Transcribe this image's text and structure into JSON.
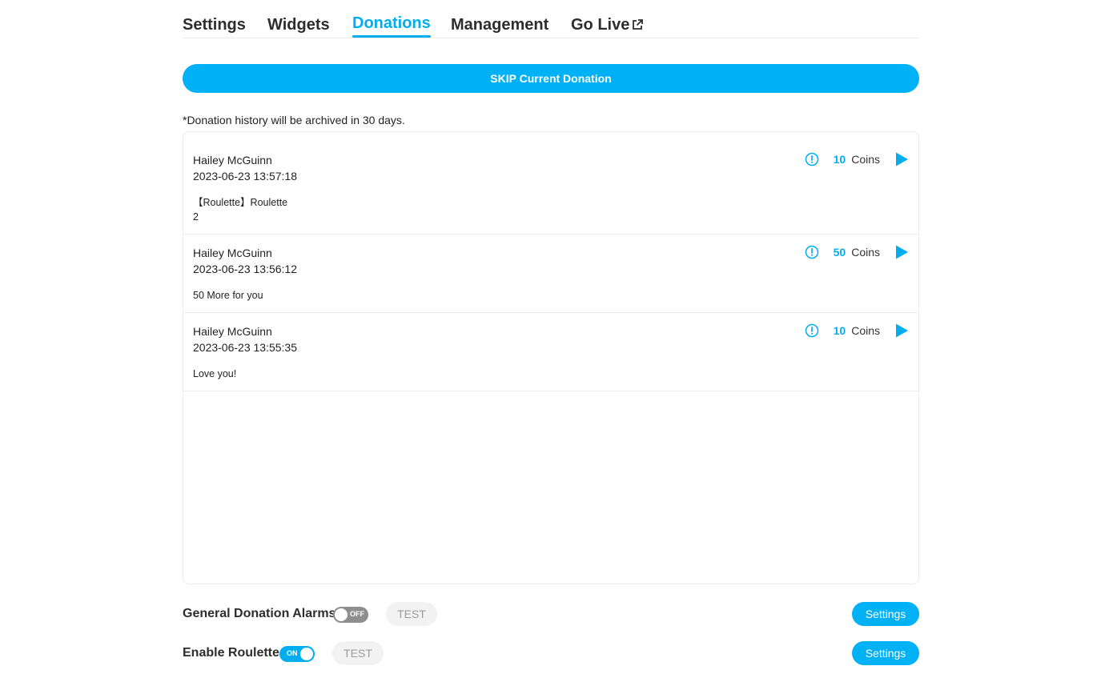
{
  "tabs": [
    {
      "label": "Settings"
    },
    {
      "label": "Widgets"
    },
    {
      "label": "Donations",
      "active": true
    },
    {
      "label": "Management"
    },
    {
      "label": "Go Live",
      "icon": "external-link-icon"
    }
  ],
  "skip_label": "SKIP Current Donation",
  "notice": "*Donation history will be archived in 30 days.",
  "donations": [
    {
      "name": "Hailey McGuinn",
      "time": "2023-06-23 13:57:18",
      "message_line1": "【Roulette】Roulette",
      "message_line2": "2",
      "amount": "10",
      "unit": "Coins"
    },
    {
      "name": "Hailey McGuinn",
      "time": "2023-06-23 13:56:12",
      "message_line1": "50 More for you",
      "amount": "50",
      "unit": "Coins"
    },
    {
      "name": "Hailey McGuinn",
      "time": "2023-06-23 13:55:35",
      "message_line1": "Love you!",
      "amount": "10",
      "unit": "Coins"
    }
  ],
  "controls": [
    {
      "label": "General Donation Alarms",
      "toggle": "OFF",
      "test": "TEST",
      "settings": "Settings"
    },
    {
      "label": "Enable Roulette",
      "toggle": "ON",
      "test": "TEST",
      "settings": "Settings"
    }
  ],
  "colors": {
    "accent": "#00aeef",
    "toggle_off": "#8e8e8e"
  }
}
